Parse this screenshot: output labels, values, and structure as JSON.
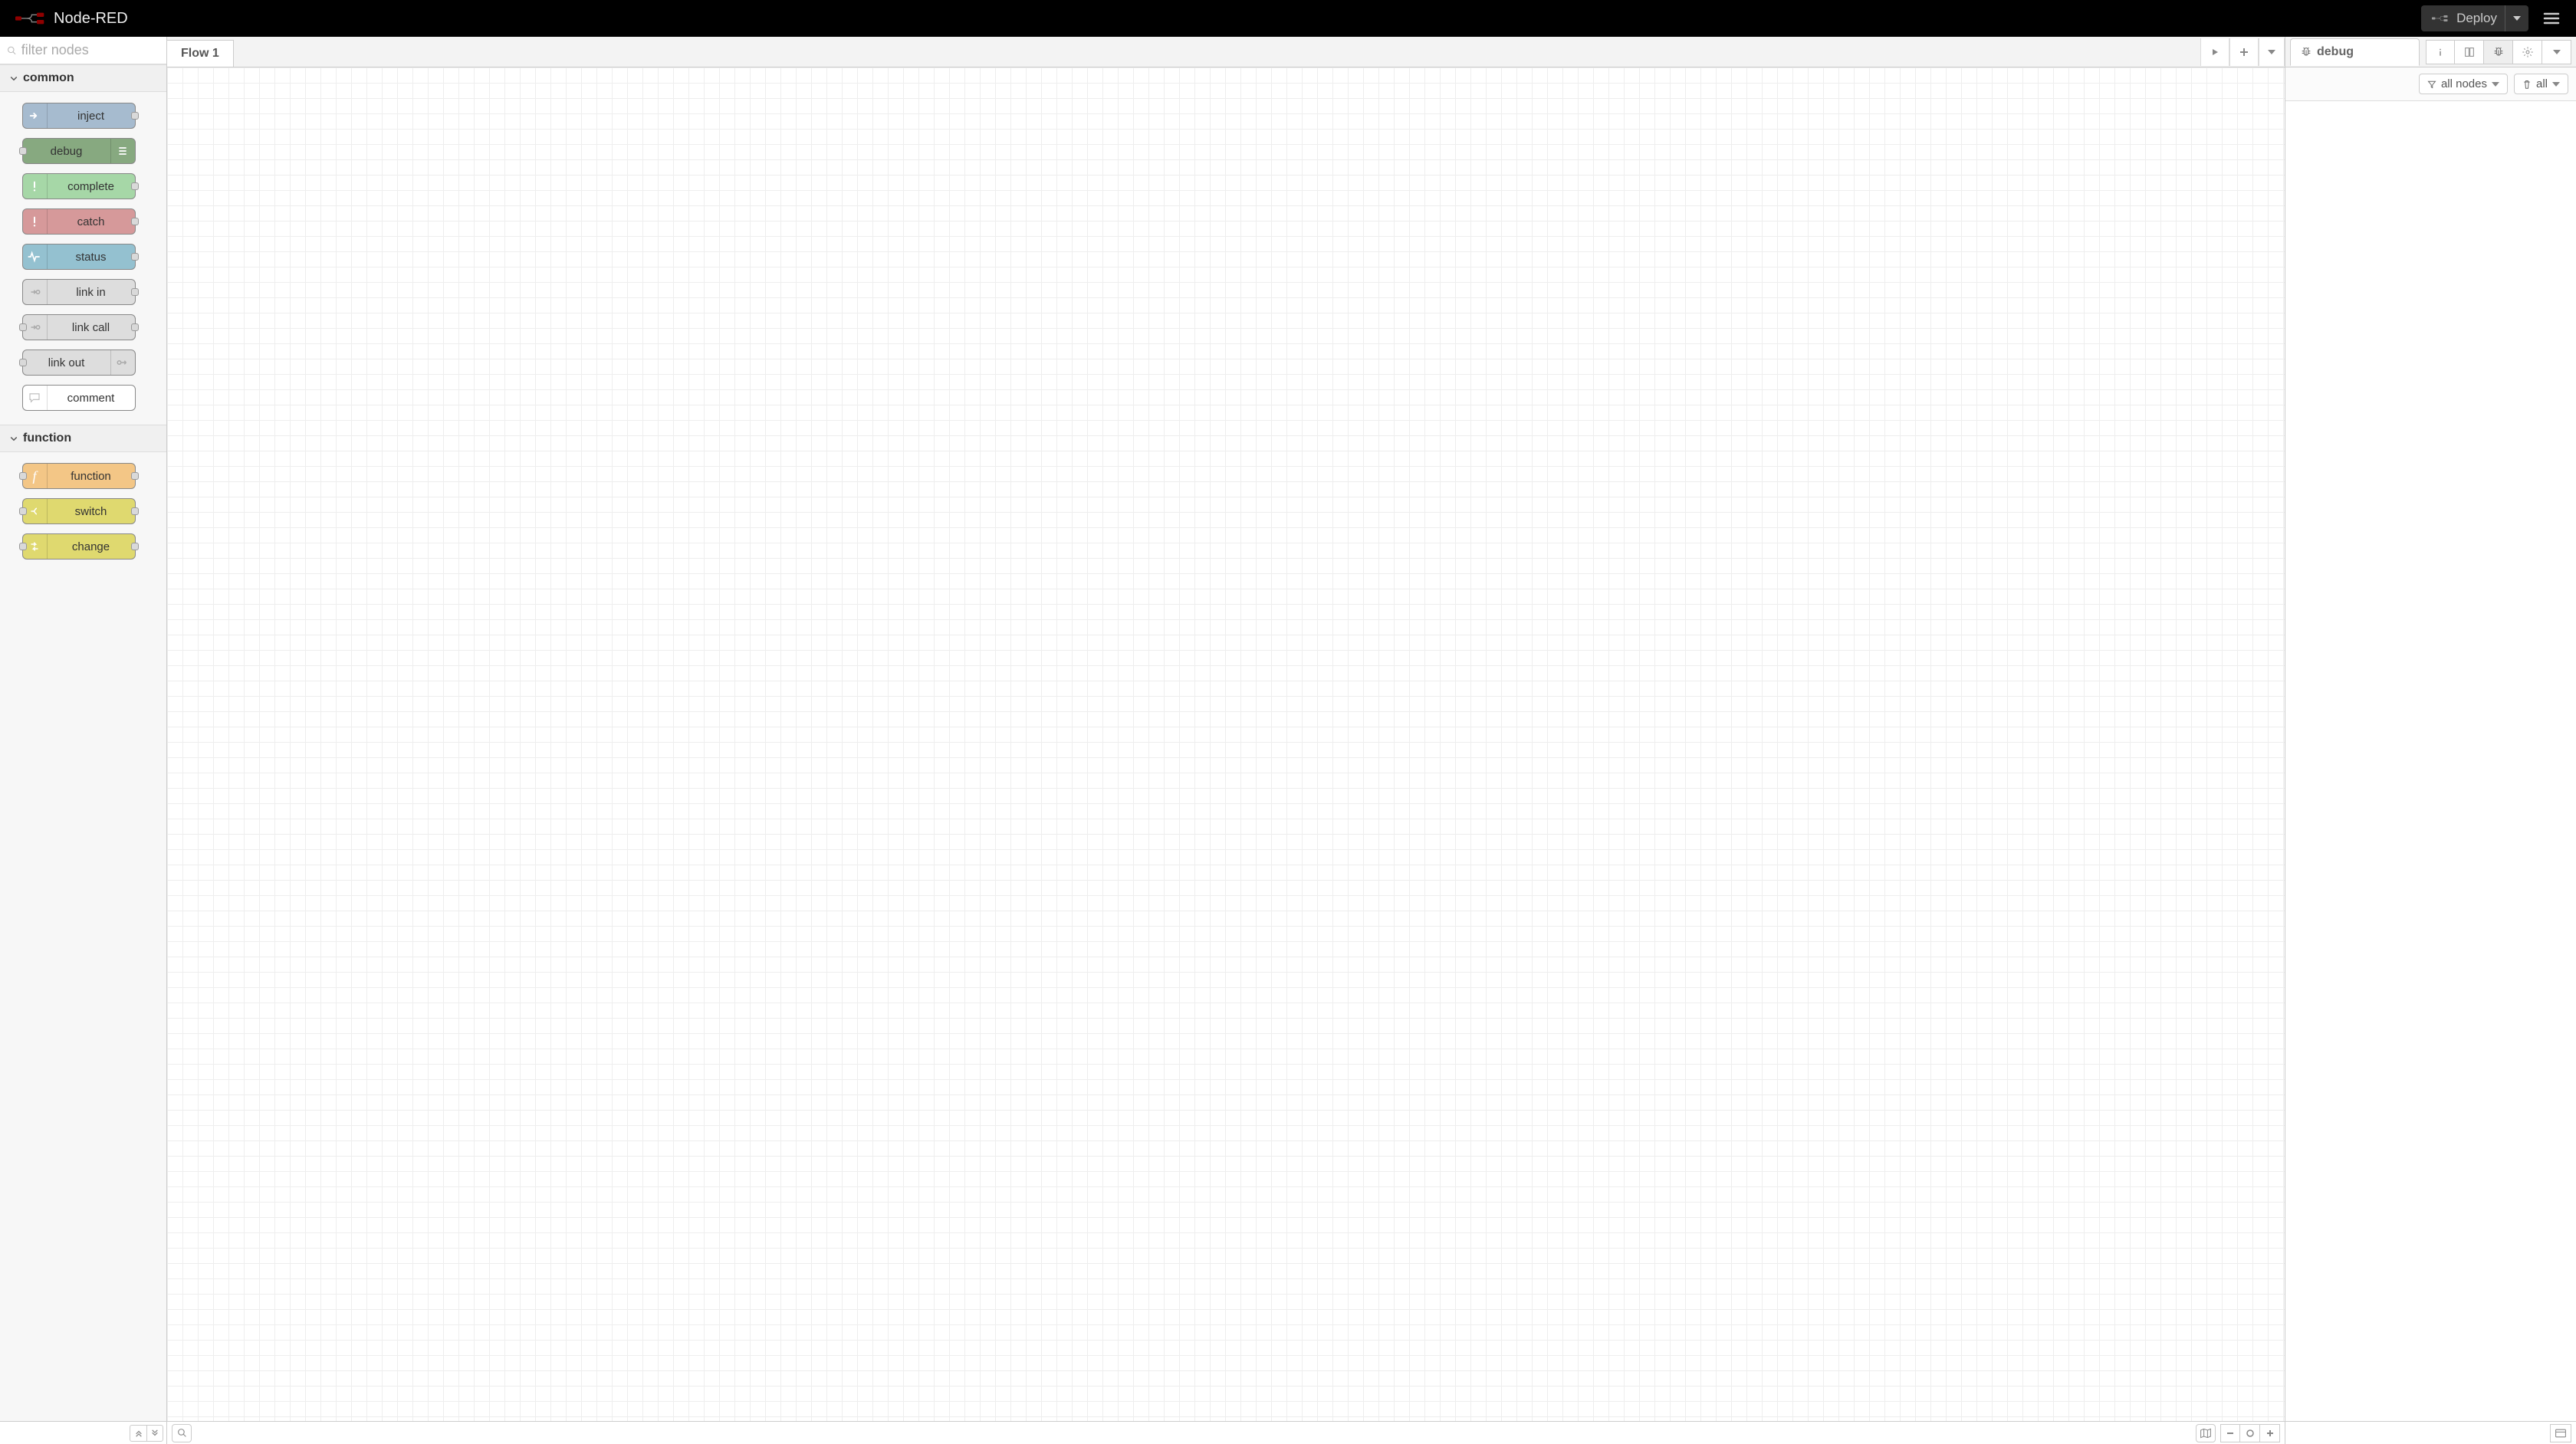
{
  "header": {
    "title": "Node-RED",
    "deploy_label": "Deploy"
  },
  "palette": {
    "search_placeholder": "filter nodes",
    "categories": [
      {
        "name": "common",
        "nodes": [
          {
            "label": "inject",
            "color": "node-inject",
            "port_in": false,
            "port_out": true,
            "icon": "arrow-right",
            "icon_side": "left"
          },
          {
            "label": "debug",
            "color": "node-debug",
            "port_in": true,
            "port_out": false,
            "icon": "list",
            "icon_side": "right"
          },
          {
            "label": "complete",
            "color": "node-complete",
            "port_in": false,
            "port_out": true,
            "icon": "exclaim",
            "icon_side": "left"
          },
          {
            "label": "catch",
            "color": "node-catch",
            "port_in": false,
            "port_out": true,
            "icon": "exclaim",
            "icon_side": "left"
          },
          {
            "label": "status",
            "color": "node-status",
            "port_in": false,
            "port_out": true,
            "icon": "pulse",
            "icon_side": "left"
          },
          {
            "label": "link in",
            "color": "node-link",
            "port_in": false,
            "port_out": true,
            "icon": "link-in",
            "icon_side": "left"
          },
          {
            "label": "link call",
            "color": "node-link",
            "port_in": true,
            "port_out": true,
            "icon": "link-in",
            "icon_side": "left"
          },
          {
            "label": "link out",
            "color": "node-link",
            "port_in": true,
            "port_out": false,
            "icon": "link-out",
            "icon_side": "right"
          },
          {
            "label": "comment",
            "color": "node-comment",
            "port_in": false,
            "port_out": false,
            "icon": "bubble",
            "icon_side": "left"
          }
        ]
      },
      {
        "name": "function",
        "nodes": [
          {
            "label": "function",
            "color": "node-function-c",
            "port_in": true,
            "port_out": true,
            "icon": "f",
            "icon_side": "left"
          },
          {
            "label": "switch",
            "color": "node-switch-c",
            "port_in": true,
            "port_out": true,
            "icon": "branch",
            "icon_side": "left"
          },
          {
            "label": "change",
            "color": "node-change-c",
            "port_in": true,
            "port_out": true,
            "icon": "swap",
            "icon_side": "left"
          }
        ]
      }
    ]
  },
  "workspace": {
    "tabs": [
      {
        "label": "Flow 1"
      }
    ]
  },
  "sidebar": {
    "active_tab_label": "debug",
    "filter_label": "all nodes",
    "clear_label": "all"
  }
}
